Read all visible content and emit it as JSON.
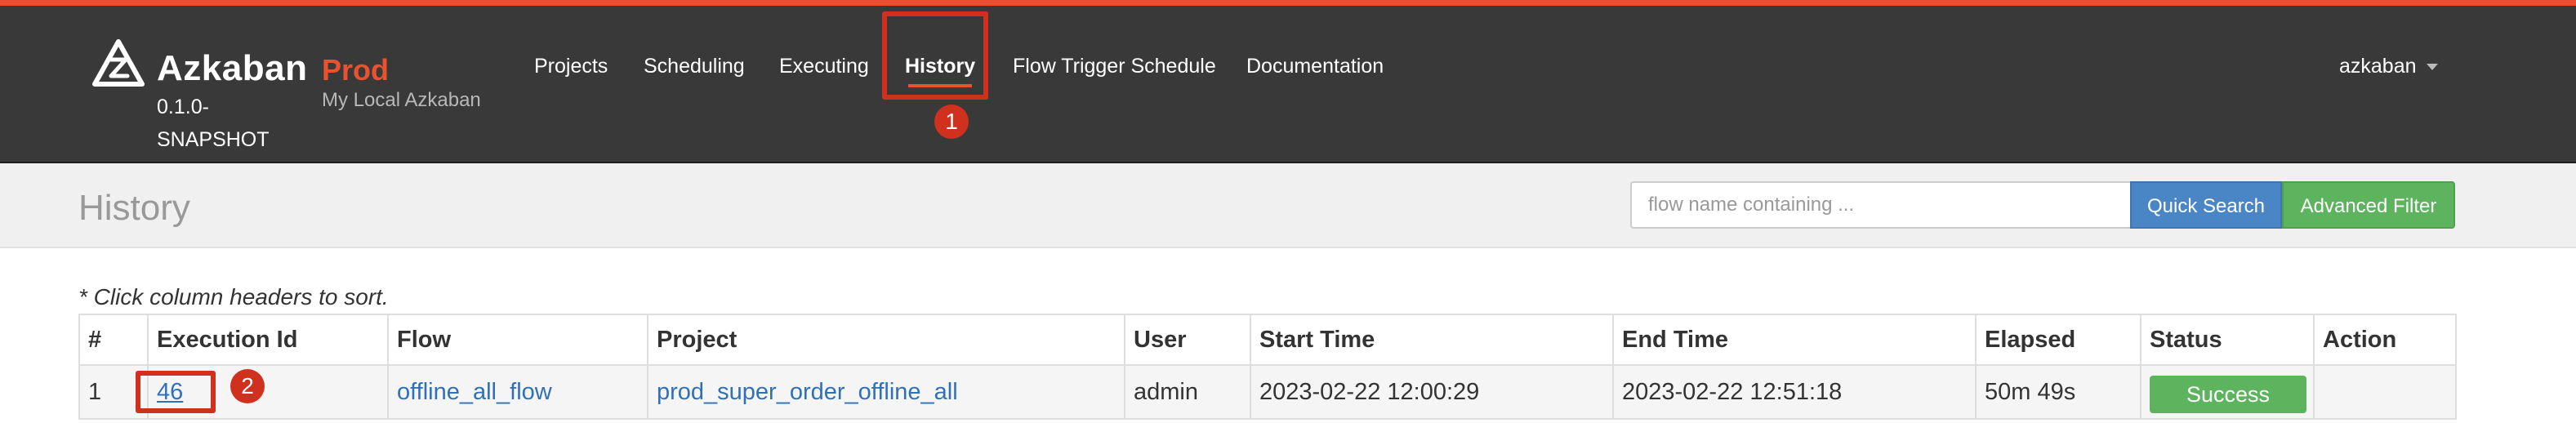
{
  "header": {
    "brand_name": "Azkaban",
    "brand_version": "0.1.0-SNAPSHOT",
    "env_name": "Prod",
    "env_desc": "My Local Azkaban",
    "nav": [
      "Projects",
      "Scheduling",
      "Executing",
      "History",
      "Flow Trigger Schedule",
      "Documentation"
    ],
    "active_nav": "History",
    "user": "azkaban"
  },
  "annotations": [
    "1",
    "2"
  ],
  "subheader": {
    "title": "History",
    "search_placeholder": "flow name containing ...",
    "quick_search_label": "Quick Search",
    "advanced_filter_label": "Advanced Filter"
  },
  "table": {
    "sort_hint": "* Click column headers to sort.",
    "columns": [
      "#",
      "Execution Id",
      "Flow",
      "Project",
      "User",
      "Start Time",
      "End Time",
      "Elapsed",
      "Status",
      "Action"
    ],
    "rows": [
      {
        "index": "1",
        "execution_id": "46",
        "flow": "offline_all_flow",
        "project": "prod_super_order_offline_all",
        "user": "admin",
        "start_time": "2023-02-22 12:00:29",
        "end_time": "2023-02-22 12:51:18",
        "elapsed": "50m 49s",
        "status": "Success",
        "action": ""
      }
    ]
  },
  "colors": {
    "accent": "#e8522f",
    "topbar": "#393939",
    "annotation": "#d0311f",
    "link": "#3070b8",
    "success": "#5eb35e",
    "quick_search": "#4a86c5"
  }
}
